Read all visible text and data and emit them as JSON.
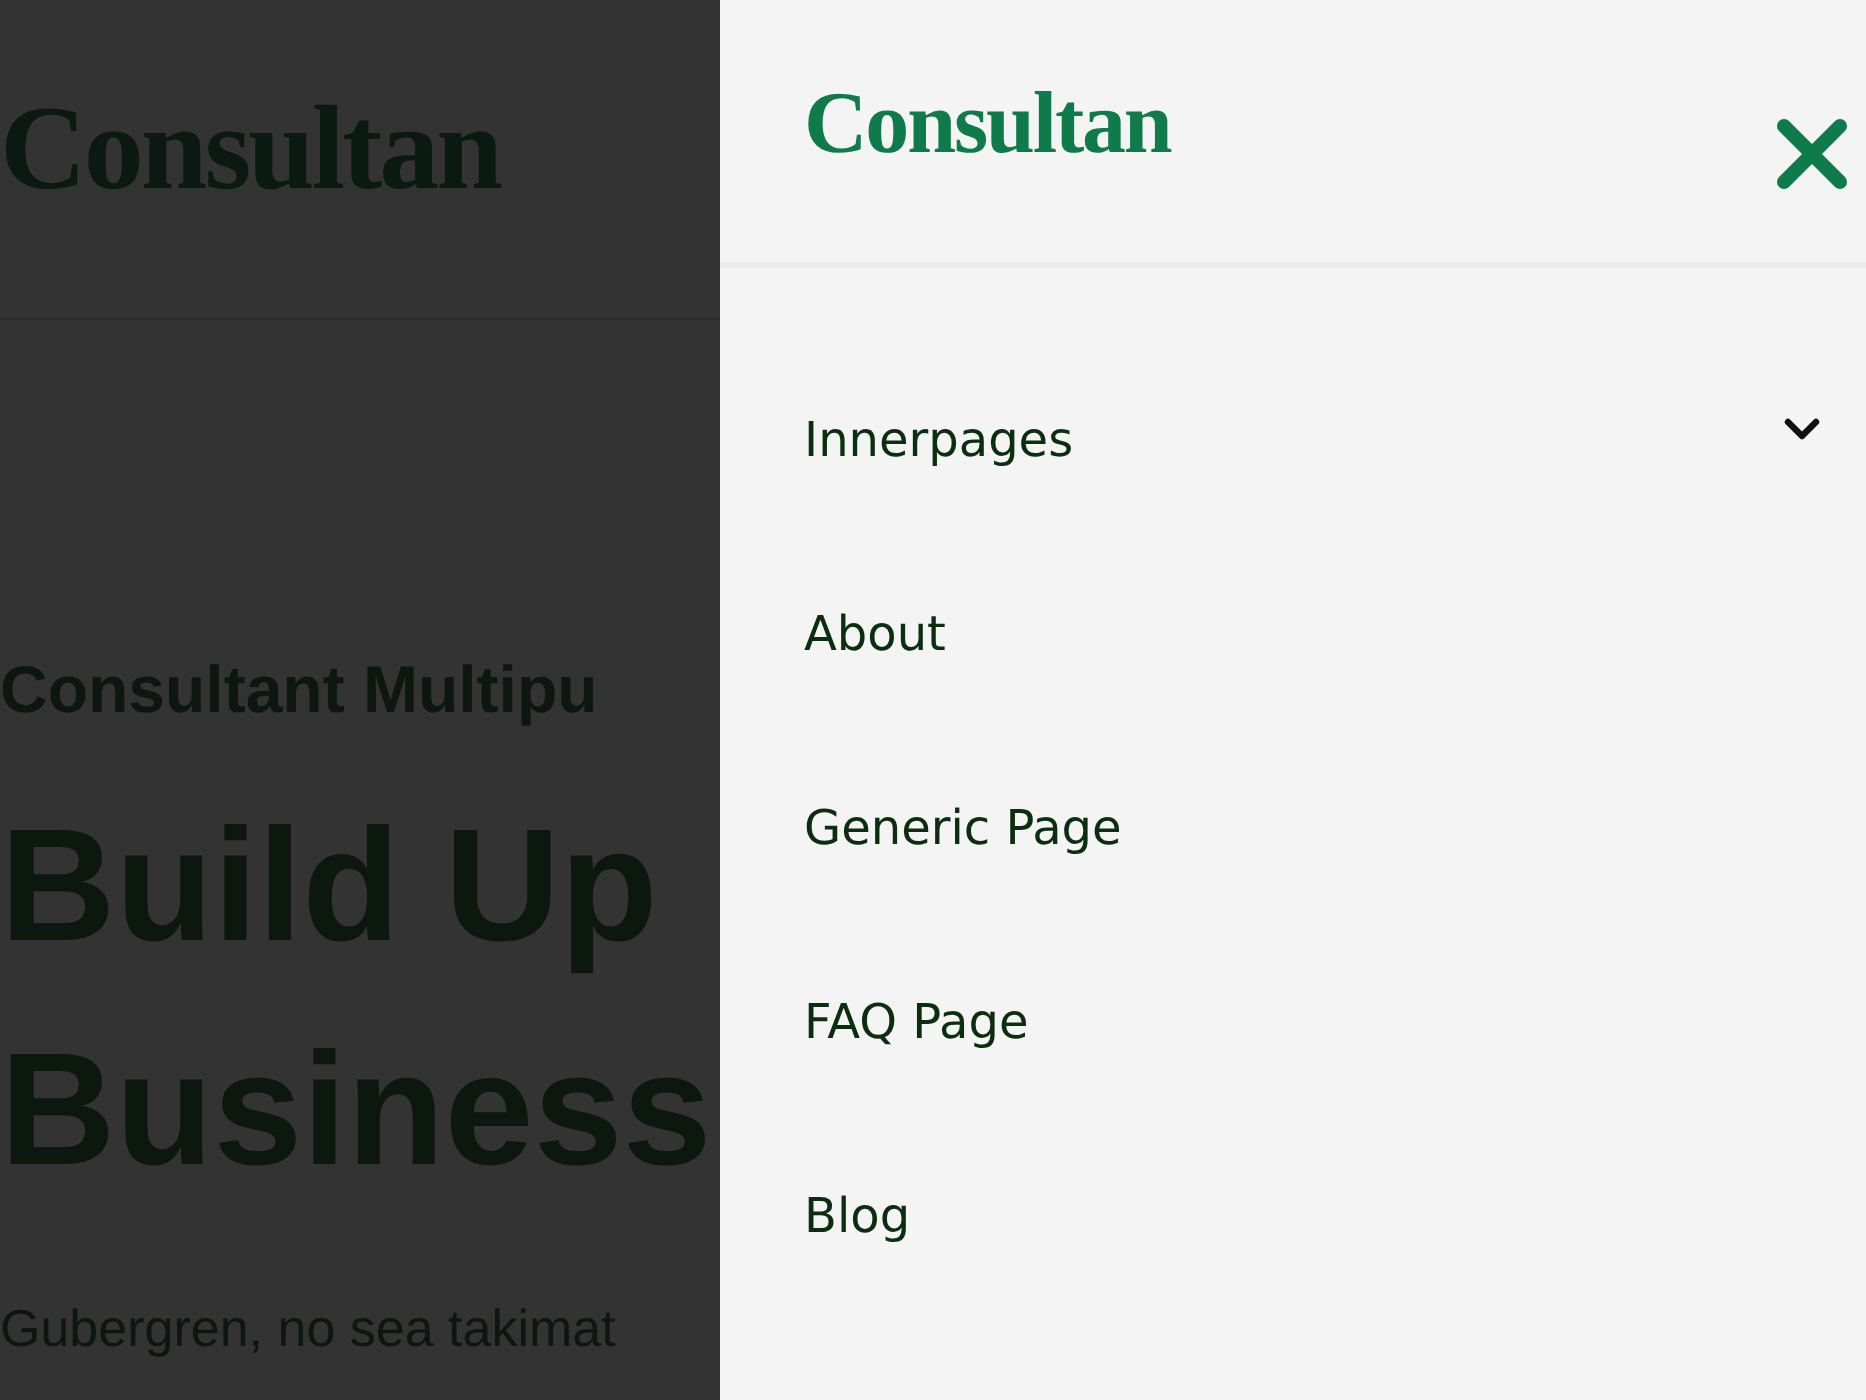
{
  "page": {
    "logo": "Consultan",
    "eyebrow": "Consultant Multipu",
    "heading_lines": [
      "Build Up",
      "Business"
    ],
    "intro": "Gubergren, no sea takimat"
  },
  "drawer": {
    "logo": "Consultan",
    "items": [
      {
        "label": "Innerpages",
        "kind": "dropdown",
        "expanded": false
      },
      {
        "label": "About",
        "kind": "link"
      },
      {
        "label": "Generic Page",
        "kind": "link"
      },
      {
        "label": "FAQ Page",
        "kind": "link"
      },
      {
        "label": "Blog",
        "kind": "link"
      }
    ]
  }
}
